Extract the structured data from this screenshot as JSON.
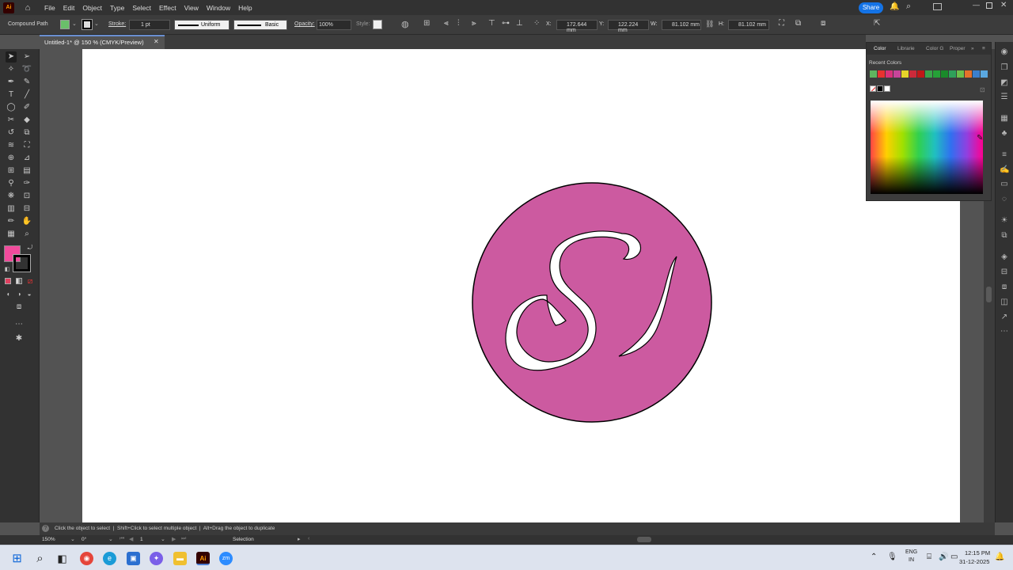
{
  "app": {
    "logo": "Ai",
    "accent": "#ff9a00"
  },
  "menu": [
    "File",
    "Edit",
    "Object",
    "Type",
    "Select",
    "Effect",
    "View",
    "Window",
    "Help"
  ],
  "share_label": "Share",
  "control_bar": {
    "selection_type": "Compound Path",
    "fill_color": "#6abf6a",
    "stroke_label": "Stroke:",
    "stroke_weight": "1 pt",
    "stroke_profile": "Uniform",
    "brush": "Basic",
    "opacity_label": "Opacity:",
    "opacity": "100%",
    "style_label": "Style:",
    "x_label": "X:",
    "x_value": "172.644 mm",
    "y_label": "Y:",
    "y_value": "122.224 mm",
    "w_label": "W:",
    "w_value": "81.102 mm",
    "h_label": "H:",
    "h_value": "81.102 mm"
  },
  "document_tab": "Untitled-1* @ 150 % (CMYK/Preview)",
  "swatches": {
    "fill": "#f24b9c",
    "stroke": "#000000"
  },
  "artwork": {
    "circle_fill": "#cc5aa0",
    "circle_stroke": "#000000",
    "letter_fill": "#ffffff"
  },
  "color_panel": {
    "tabs": [
      "Color",
      "Librarie",
      "Color G",
      "Proper"
    ],
    "recent_label": "Recent Colors",
    "recent_colors": [
      "#5fb55f",
      "#e8322f",
      "#d9317b",
      "#c7459a",
      "#e8d42a",
      "#cc2a3a",
      "#c01818",
      "#3aa34a",
      "#25a037",
      "#1a8a2a",
      "#2fa05a",
      "#6cbf4a",
      "#e5722a",
      "#3b7fcc",
      "#5aa8e0"
    ]
  },
  "status_hint": "Click the object to select  |  Shift+Click to select multiple object  |  Alt+Drag the object to duplicate",
  "bottom": {
    "zoom": "150%",
    "rotation": "0°",
    "artboard_num": "1",
    "tool": "Selection"
  },
  "taskbar": {
    "lang": "ENG",
    "region": "IN",
    "time": "12:15 PM",
    "date": "31-12-2025"
  }
}
